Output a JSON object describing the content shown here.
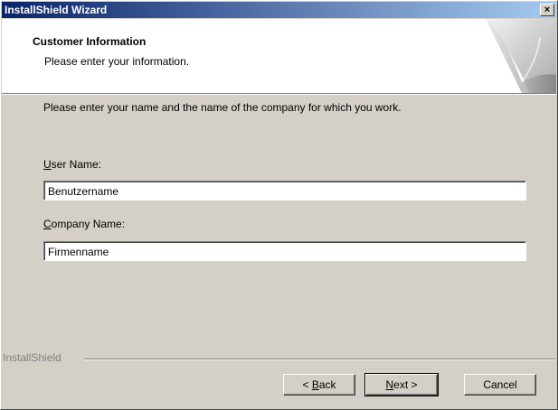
{
  "window": {
    "title": "InstallShield Wizard",
    "close_label": "×"
  },
  "header": {
    "title": "Customer Information",
    "subtitle": "Please enter your information."
  },
  "body": {
    "intro": "Please enter your name and the name of the company for which you work.",
    "user_name": {
      "label_accel": "U",
      "label_rest": "ser Name:",
      "value": "Benutzername"
    },
    "company_name": {
      "label_accel": "C",
      "label_rest": "ompany Name:",
      "value": "Firmenname"
    }
  },
  "footer": {
    "brand": "InstallShield",
    "back": {
      "prefix": "< ",
      "accel": "B",
      "rest": "ack"
    },
    "next": {
      "accel": "N",
      "rest": "ext >"
    },
    "cancel": "Cancel"
  }
}
